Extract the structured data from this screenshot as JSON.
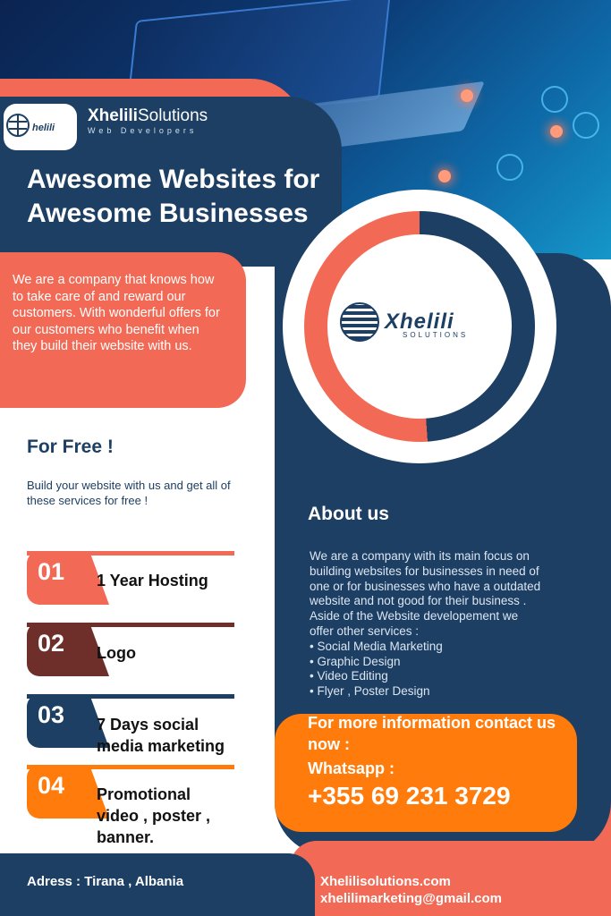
{
  "brand": {
    "name_bold": "Xhelili",
    "name_regular": "Solutions",
    "tagline": "Web Developers",
    "logo_text": "Xhelili",
    "logo_sub": "SOLUTIONS"
  },
  "headline": "Awesome Websites for Awesome Businesses",
  "intro": "We are a company that knows how to take care of and reward our customers. With wonderful offers for our customers who benefit when they build their website with us.",
  "free": {
    "title": "For Free !",
    "description": "Build your website with us and get all of these services for free !",
    "services": [
      {
        "number": "01",
        "label": "1 Year Hosting",
        "color": "#f26a55"
      },
      {
        "number": "02",
        "label": "Logo",
        "color": "#6e2f2a"
      },
      {
        "number": "03",
        "label": "7 Days social media marketing",
        "color": "#1d3f63"
      },
      {
        "number": "04",
        "label": "Promotional video , poster , banner.",
        "color": "#ff7b0c"
      }
    ]
  },
  "about": {
    "title": "About us",
    "body": "We are a company with its main focus on building websites for businesses in need of one or for businesses who have a outdated website and not good for their business . Aside of the Website developement we offer other services :",
    "list": [
      "• Social Media Marketing",
      "• Graphic Design",
      "• Video Editing",
      "• Flyer , Poster Design"
    ]
  },
  "contact": {
    "prompt": "For more information contact us now :",
    "whatsapp_label": "Whatsapp :",
    "whatsapp_number": "+355 69 231 3729"
  },
  "footer": {
    "address": "Adress : Tirana , Albania",
    "website": "Xhelilisolutions.com",
    "email": "xhelilimarketing@gmail.com"
  },
  "colors": {
    "navy": "#1d3f63",
    "salmon": "#f26a55",
    "orange": "#ff7b0c",
    "maroon": "#6e2f2a"
  }
}
